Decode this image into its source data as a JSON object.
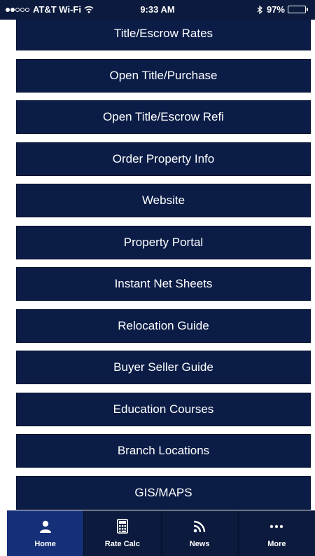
{
  "status_bar": {
    "carrier": "AT&T Wi-Fi",
    "time": "9:33 AM",
    "battery": "97%",
    "battery_level": 0.97,
    "signal_bars": 2,
    "icons": [
      "signal-dots-icon",
      "wifi-icon",
      "bluetooth-icon",
      "battery-icon"
    ]
  },
  "menu": {
    "items": [
      {
        "label": "Title/Escrow Rates"
      },
      {
        "label": "Open Title/Purchase"
      },
      {
        "label": "Open Title/Escrow Refi"
      },
      {
        "label": "Order Property Info"
      },
      {
        "label": "Website"
      },
      {
        "label": "Property Portal"
      },
      {
        "label": "Instant Net Sheets"
      },
      {
        "label": "Relocation Guide"
      },
      {
        "label": "Buyer Seller Guide"
      },
      {
        "label": "Education Courses"
      },
      {
        "label": "Branch Locations"
      },
      {
        "label": "GIS/MAPS"
      }
    ]
  },
  "tab_bar": {
    "tabs": [
      {
        "label": "Home",
        "icon": "person-icon",
        "active": true
      },
      {
        "label": "Rate Calc",
        "icon": "calculator-icon",
        "active": false
      },
      {
        "label": "News",
        "icon": "rss-icon",
        "active": false
      },
      {
        "label": "More",
        "icon": "more-dots-icon",
        "active": false
      }
    ]
  },
  "colors": {
    "status_bar_bg": "#0b1a3d",
    "button_bg": "#0b1d47",
    "tab_bar_bg": "#0b1a3d",
    "active_tab_bg": "#153078",
    "text": "#ffffff",
    "page_bg": "#ffffff"
  }
}
